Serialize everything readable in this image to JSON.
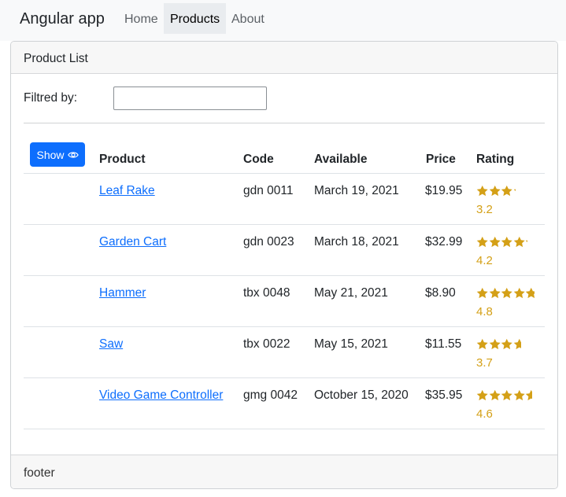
{
  "navbar": {
    "brand": "Angular app",
    "links": [
      "Home",
      "Products",
      "About"
    ]
  },
  "card": {
    "header": "Product List",
    "footer": "footer"
  },
  "filter": {
    "label": "Filtred by:",
    "value": ""
  },
  "show_button": {
    "label": "Show",
    "icon": "eye-icon"
  },
  "table": {
    "headers": [
      "Product",
      "Code",
      "Available",
      "Price",
      "Rating"
    ],
    "rows": [
      {
        "name": "Leaf Rake",
        "code": "gdn 0011",
        "available": "March 19, 2021",
        "price": "$19.95",
        "rating": "3.2"
      },
      {
        "name": "Garden Cart",
        "code": "gdn 0023",
        "available": "March 18, 2021",
        "price": "$32.99",
        "rating": "4.2"
      },
      {
        "name": "Hammer",
        "code": "tbx 0048",
        "available": "May 21, 2021",
        "price": "$8.90",
        "rating": "4.8"
      },
      {
        "name": "Saw",
        "code": "tbx 0022",
        "available": "May 15, 2021",
        "price": "$11.55",
        "rating": "3.7"
      },
      {
        "name": "Video Game Controller",
        "code": "gmg 0042",
        "available": "October 15, 2020",
        "price": "$35.95",
        "rating": "4.6"
      }
    ]
  },
  "colors": {
    "primary": "#0d6efd",
    "star": "#d4a017",
    "navbar_bg": "#f8f9fa"
  }
}
